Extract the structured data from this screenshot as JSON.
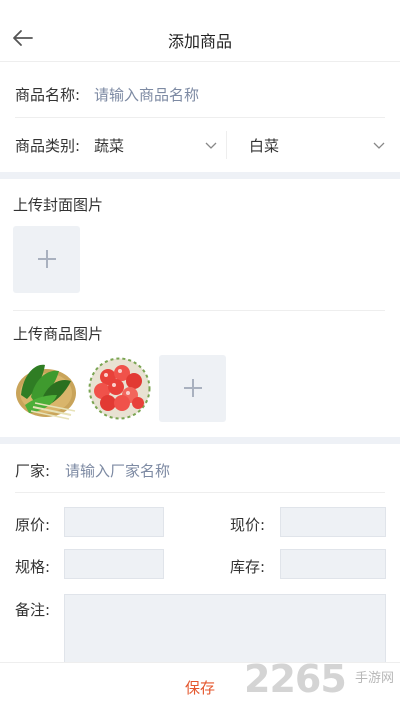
{
  "header": {
    "title": "添加商品",
    "back_icon": "arrow-left-icon"
  },
  "form": {
    "name_label": "商品名称:",
    "name_placeholder": "请输入商品名称",
    "category_label": "商品类别:",
    "category_primary": "蔬菜",
    "category_secondary": "白菜",
    "cover_label": "上传封面图片",
    "goods_images_label": "上传商品图片",
    "goods_images": [
      {
        "name": "spinach-image"
      },
      {
        "name": "tomatoes-image"
      }
    ],
    "manufacturer_label": "厂家:",
    "manufacturer_placeholder": "请输入厂家名称",
    "original_price_label": "原价:",
    "current_price_label": "现价:",
    "spec_label": "规格:",
    "stock_label": "库存:",
    "remark_label": "备注:"
  },
  "footer": {
    "save_label": "保存"
  },
  "watermark": {
    "number": "2265",
    "site": "手游网"
  },
  "colors": {
    "accent": "#e4572e",
    "placeholder": "#7d8aa3",
    "input_bg": "#eef1f5",
    "section_bg": "#eef1f6"
  }
}
